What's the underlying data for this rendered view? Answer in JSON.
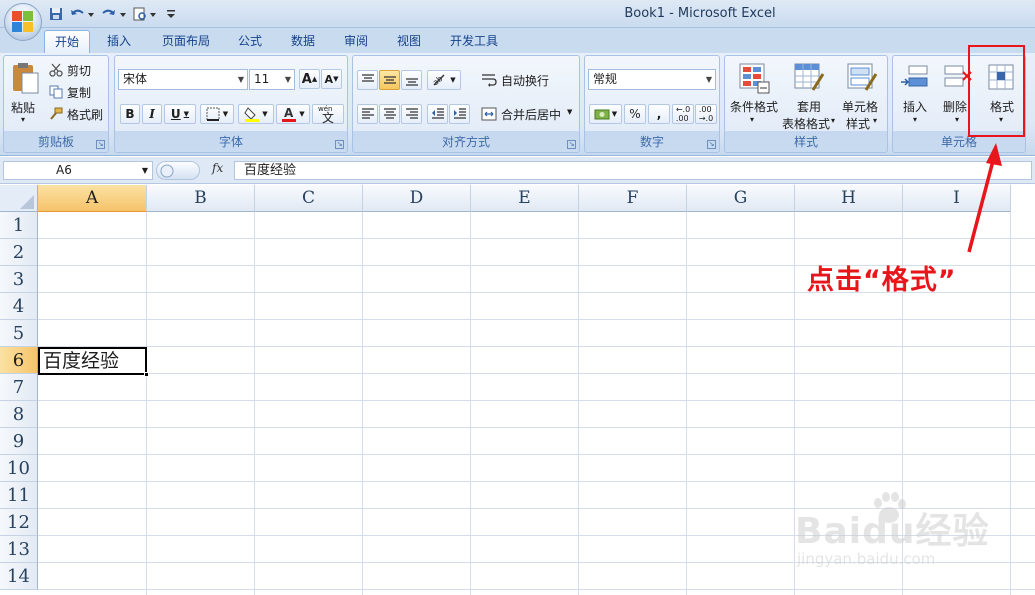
{
  "window": {
    "title": "Book1 - Microsoft Excel"
  },
  "tabs": [
    "开始",
    "插入",
    "页面布局",
    "公式",
    "数据",
    "审阅",
    "视图",
    "开发工具"
  ],
  "active_tab": "开始",
  "ribbon": {
    "clipboard": {
      "paste": "粘贴",
      "cut": "剪切",
      "copy": "复制",
      "format_painter": "格式刷",
      "label": "剪贴板"
    },
    "font": {
      "name": "宋体",
      "size": "11",
      "bold": "B",
      "italic": "I",
      "underline": "U",
      "phonetic": "wén",
      "label": "字体"
    },
    "alignment": {
      "wrap_text": "自动换行",
      "merge_center": "合并后居中",
      "label": "对齐方式"
    },
    "number": {
      "format": "常规",
      "percent": "%",
      "comma": ",",
      "label": "数字"
    },
    "styles": {
      "conditional": "条件格式",
      "table_format_1": "套用",
      "table_format_2": "表格格式",
      "cell_styles_1": "单元格",
      "cell_styles_2": "样式",
      "label": "样式"
    },
    "cells": {
      "insert": "插入",
      "delete": "删除",
      "format": "格式",
      "label": "单元格"
    }
  },
  "formula_bar": {
    "name_box": "A6",
    "fx": "fx",
    "content": "百度经验"
  },
  "sheet": {
    "columns": [
      "A",
      "B",
      "C",
      "D",
      "E",
      "F",
      "G",
      "H",
      "I"
    ],
    "rows": [
      "1",
      "2",
      "3",
      "4",
      "5",
      "6",
      "7",
      "8",
      "9",
      "10",
      "11",
      "12",
      "13",
      "14"
    ],
    "selected_column": "A",
    "selected_row": "6",
    "active_cell": {
      "ref": "A6",
      "value": "百度经验"
    }
  },
  "annotation": {
    "text": "点击“格式”",
    "color": "#e8151a"
  },
  "watermark": {
    "brand": "Baidu经验",
    "url": "jingyan.baidu.com"
  },
  "colors": {
    "accent": "#e8151a",
    "selection": "#f5c36a",
    "ribbon": "#dde8f6"
  }
}
